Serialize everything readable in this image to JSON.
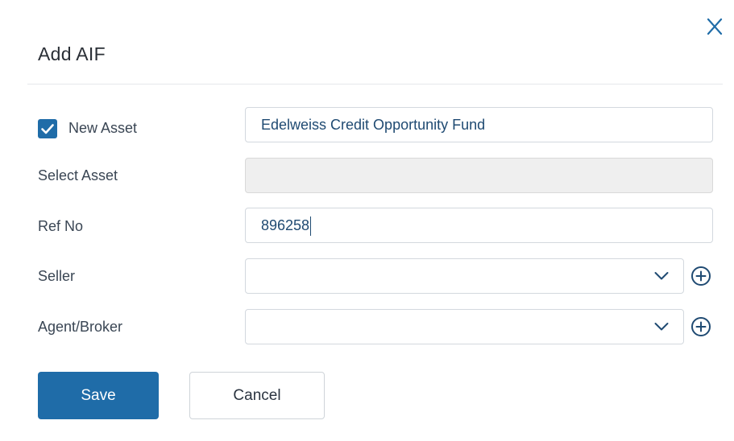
{
  "dialog": {
    "title": "Add AIF",
    "close_icon": "close-icon"
  },
  "form": {
    "new_asset": {
      "label": "New Asset",
      "checked": true,
      "value": "Edelweiss Credit Opportunity Fund"
    },
    "select_asset": {
      "label": "Select Asset",
      "value": ""
    },
    "ref_no": {
      "label": "Ref No",
      "value": "896258"
    },
    "seller": {
      "label": "Seller",
      "value": ""
    },
    "agent_broker": {
      "label": "Agent/Broker",
      "value": ""
    }
  },
  "buttons": {
    "save": "Save",
    "cancel": "Cancel"
  },
  "colors": {
    "accent": "#1f6ca8"
  }
}
